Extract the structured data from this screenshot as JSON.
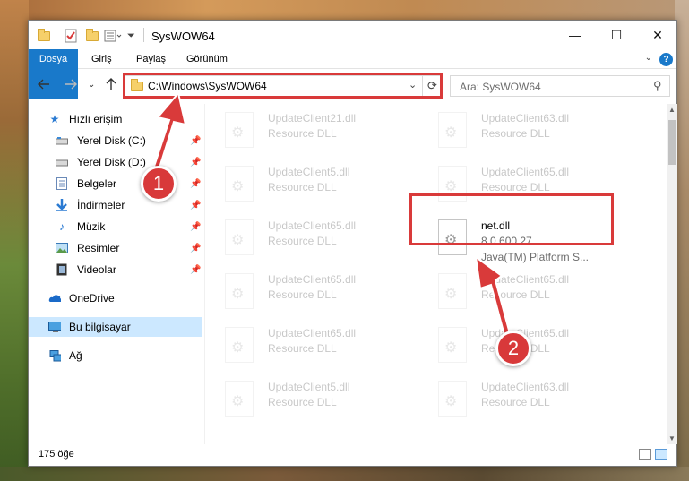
{
  "window": {
    "title": "SysWOW64",
    "minimize": "—",
    "maximize": "☐",
    "close": "✕"
  },
  "ribbon": {
    "tabs": [
      "Dosya",
      "Giriş",
      "Paylaş",
      "Görünüm"
    ],
    "help": "?"
  },
  "address": {
    "path": "C:\\Windows\\SysWOW64",
    "search_placeholder": "Ara: SysWOW64"
  },
  "nav": {
    "quick_access": "Hızlı erişim",
    "items": [
      {
        "label": "Yerel Disk (C:)",
        "icon": "drive-icon"
      },
      {
        "label": "Yerel Disk (D:)",
        "icon": "drive-icon"
      },
      {
        "label": "Belgeler",
        "icon": "documents-icon"
      },
      {
        "label": "İndirmeler",
        "icon": "downloads-icon"
      },
      {
        "label": "Müzik",
        "icon": "music-icon"
      },
      {
        "label": "Resimler",
        "icon": "pictures-icon"
      },
      {
        "label": "Videolar",
        "icon": "videos-icon"
      }
    ],
    "onedrive": "OneDrive",
    "this_pc": "Bu bilgisayar",
    "network": "Ağ"
  },
  "files": [
    {
      "name": "UpdateClient21.dll",
      "desc": "Resource DLL"
    },
    {
      "name": "UpdateClient63.dll",
      "desc": "Resource DLL"
    },
    {
      "name": "UpdateClient5.dll",
      "desc": "Resource DLL"
    },
    {
      "name": "UpdateClient65.dll",
      "desc": "Resource DLL"
    },
    {
      "name": "UpdateClient65.dll",
      "desc": "Resource DLL"
    },
    {
      "name": "net.dll",
      "desc": "8.0.600.27",
      "desc2": "Java(TM) Platform S..."
    },
    {
      "name": "UpdateClient65.dll",
      "desc": "Resource DLL"
    },
    {
      "name": "UpdateClient65.dll",
      "desc": "Resource DLL"
    },
    {
      "name": "UpdateClient65.dll",
      "desc": "Resource DLL"
    },
    {
      "name": "UpdateClient65.dll",
      "desc": "Resource DLL"
    },
    {
      "name": "UpdateClient5.dll",
      "desc": "Resource DLL"
    },
    {
      "name": "UpdateClient63.dll",
      "desc": "Resource DLL"
    }
  ],
  "status": {
    "count": "175 öğe"
  },
  "annotations": {
    "badge1": "1",
    "badge2": "2",
    "color": "#d93a3a"
  }
}
